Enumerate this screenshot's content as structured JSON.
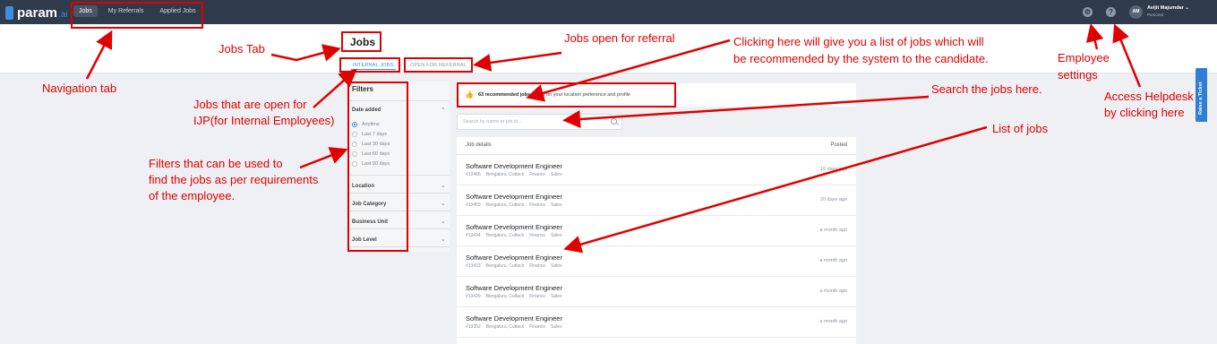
{
  "app": {
    "logo_text": "param",
    "logo_suffix": ".ai"
  },
  "nav": {
    "items": [
      "Jobs",
      "My Referrals",
      "Applied Jobs"
    ],
    "active": "Jobs"
  },
  "user": {
    "initials": "AM",
    "name": "Avijit Majumdar ⌄",
    "role": "Personal"
  },
  "page": {
    "title": "Jobs",
    "tabs": [
      "INTERNAL JOBS",
      "OPEN FOR REFERRAL"
    ]
  },
  "filters": {
    "title": "Filters",
    "date_added": {
      "label": "Date added",
      "options": [
        "Anytime",
        "Last 7 days",
        "Last 30 days",
        "Last 60 days",
        "Last 90 days"
      ],
      "selected": "Anytime"
    },
    "sections": [
      "Location",
      "Job Category",
      "Business Unit",
      "Job Level"
    ]
  },
  "recommend": {
    "count_text": "63 recommended jobs",
    "rest_text": " based on your location preference and profile"
  },
  "search": {
    "placeholder": "Search by name or job id..."
  },
  "jobs_table": {
    "col_left": "Job details",
    "col_right": "Posted",
    "rows": [
      {
        "title": "Software Development Engineer",
        "id": "#13486",
        "location": "Bengaluru, Cuttack",
        "tag1": "Finance",
        "tag2": "Sales",
        "posted": "16 days ago"
      },
      {
        "title": "Software Development Engineer",
        "id": "#13459",
        "location": "Bengaluru, Cuttack",
        "tag1": "Finance",
        "tag2": "Sales",
        "posted": "20 days ago"
      },
      {
        "title": "Software Development Engineer",
        "id": "#13434",
        "location": "Bengaluru, Cuttack",
        "tag1": "Finance",
        "tag2": "Sales",
        "posted": "a month ago"
      },
      {
        "title": "Software Development Engineer",
        "id": "#13433",
        "location": "Bengaluru, Cuttack",
        "tag1": "Finance",
        "tag2": "Sales",
        "posted": "a month ago"
      },
      {
        "title": "Software Development Engineer",
        "id": "#13429",
        "location": "Bengaluru, Cuttack",
        "tag1": "Finance",
        "tag2": "Sales",
        "posted": "a month ago"
      },
      {
        "title": "Software Development Engineer",
        "id": "#13352",
        "location": "Bengaluru, Cuttack",
        "tag1": "Finance",
        "tag2": "Sales",
        "posted": "a month ago"
      }
    ]
  },
  "raise_ticket": "Raise a Ticket",
  "annotations": {
    "navigation_tab": "Navigation tab",
    "jobs_tab": "Jobs Tab",
    "open_for_referral": "Jobs open for referral",
    "ijp_line1": "Jobs that are open for",
    "ijp_line2": "IJP(for Internal Employees)",
    "filters_line1": "Filters that can be used to",
    "filters_line2": "find the jobs as per requirements",
    "filters_line3": "of the employee.",
    "recommend_line1": "Clicking here will give you a list of jobs which will",
    "recommend_line2": "be recommended by the system to the candidate.",
    "search": "Search the jobs here.",
    "list": "List of jobs",
    "employee_line1": "Employee",
    "employee_line2": "settings",
    "helpdesk_line1": "Access Helpdesk",
    "helpdesk_line2": "by clicking here"
  },
  "colors": {
    "topbar": "#2f3a4a",
    "accent": "#3b8fe0",
    "annotation": "#e00000"
  }
}
